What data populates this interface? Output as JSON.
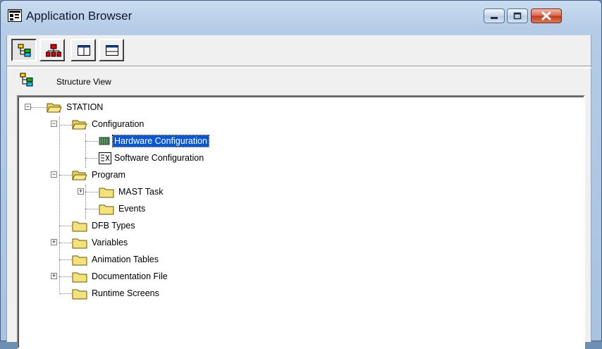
{
  "window": {
    "title": "Application Browser",
    "controls": [
      "minimize",
      "maximize",
      "close"
    ]
  },
  "toolbar": {
    "buttons": [
      {
        "name": "structure-view-tool",
        "icon": "structure-tree-icon",
        "pressed": true
      },
      {
        "name": "functional-view-tool",
        "icon": "hierarchy-icon",
        "pressed": false
      },
      {
        "name": "vertical-split-tool",
        "icon": "vertical-split-icon",
        "pressed": false
      },
      {
        "name": "horizontal-split-tool",
        "icon": "horizontal-split-icon",
        "pressed": false
      }
    ]
  },
  "view_header": {
    "label": "Structure View",
    "icon": "structure-tree-icon"
  },
  "tree": {
    "station": "STATION",
    "configuration": "Configuration",
    "hardware_configuration": "Hardware Configuration",
    "software_configuration": "Software Configuration",
    "program": "Program",
    "mast_task": "MAST Task",
    "events": "Events",
    "dfb_types": "DFB Types",
    "variables": "Variables",
    "animation_tables": "Animation Tables",
    "documentation_file": "Documentation File",
    "runtime_screens": "Runtime Screens",
    "selected": "Hardware Configuration"
  },
  "colors": {
    "selection": "#0a57d6",
    "folder": "#f4e27a",
    "titlebar": "#b5cce6"
  }
}
